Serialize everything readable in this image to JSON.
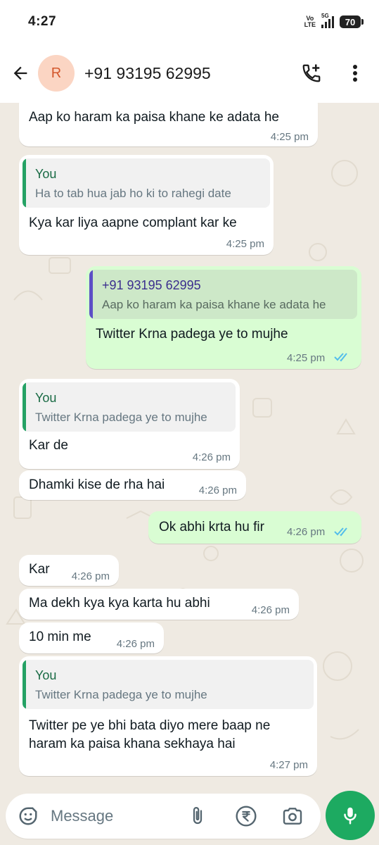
{
  "status_bar": {
    "time": "4:27",
    "network_line1": "Vo",
    "network_line2": "LTE",
    "network_type": "5G",
    "battery": "70"
  },
  "header": {
    "avatar_letter": "R",
    "contact": "+91 93195 62995"
  },
  "messages": [
    {
      "text": "Aap ko haram ka paisa khane ke adata he",
      "time": "4:25 pm"
    },
    {
      "quote_author": "You",
      "quote_text": "Ha to tab hua jab ho ki to rahegi date",
      "text": "Kya kar liya aapne complant kar ke",
      "time": "4:25 pm"
    },
    {
      "quote_author": "+91 93195 62995",
      "quote_text": "Aap ko haram ka paisa khane ke adata he",
      "text": "Twitter Krna padega ye to mujhe",
      "time": "4:25 pm"
    },
    {
      "quote_author": "You",
      "quote_text": "Twitter Krna padega ye to mujhe",
      "text": "Kar de",
      "time": "4:26 pm"
    },
    {
      "text": "Dhamki kise de rha hai",
      "time": "4:26 pm"
    },
    {
      "text": "Ok abhi krta hu fir",
      "time": "4:26 pm"
    },
    {
      "text": "Kar",
      "time": "4:26 pm"
    },
    {
      "text": "Ma dekh kya kya karta hu abhi",
      "time": "4:26 pm"
    },
    {
      "text": "10 min me",
      "time": "4:26 pm"
    },
    {
      "quote_author": "You",
      "quote_text": "Twitter Krna padega ye to mujhe",
      "text_line1": "Twitter pe ye bhi bata diyo mere baap ne",
      "text_line2": "haram ka paisa khana sekhaya hai",
      "time": "4:27 pm"
    }
  ],
  "input": {
    "placeholder": "Message"
  },
  "icons": {
    "back": "arrow-left-icon",
    "call": "add-call-icon",
    "menu": "more-vertical-icon",
    "sticker": "sticker-icon",
    "attach": "paperclip-icon",
    "payment": "rupee-icon",
    "camera": "camera-icon",
    "mic": "microphone-icon",
    "read": "double-check-icon"
  },
  "colors": {
    "chat_background": "#efeae2",
    "incoming_bubble": "#ffffff",
    "outgoing_bubble": "#d9fdd3",
    "accent_green": "#1daa61",
    "read_ticks": "#53bdeb",
    "avatar_bg": "#fbd5c3"
  }
}
